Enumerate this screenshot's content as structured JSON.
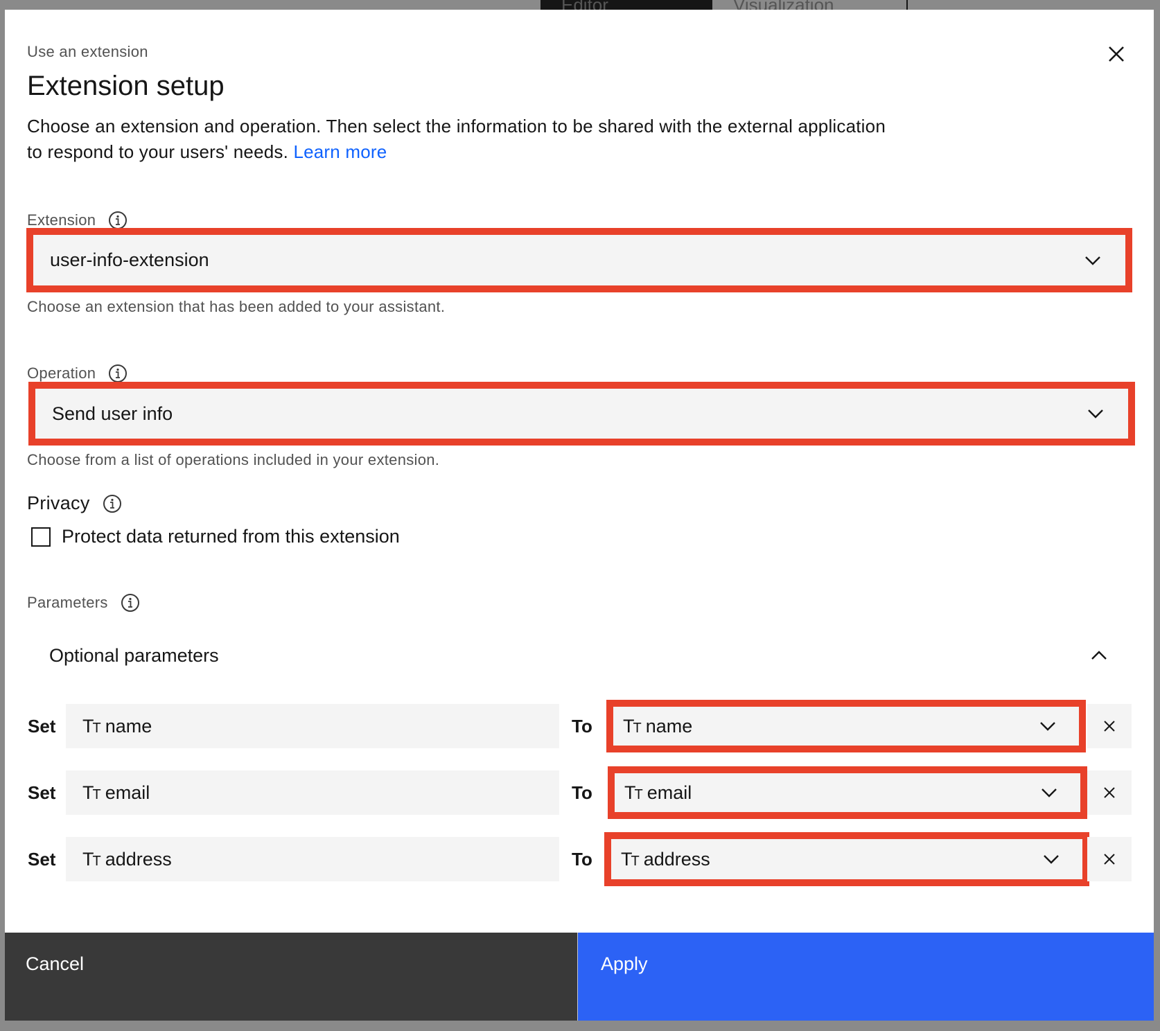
{
  "background": {
    "tabs": [
      {
        "label": "Editor",
        "active": true
      },
      {
        "label": "Visualization",
        "active": false
      }
    ]
  },
  "modal": {
    "eyebrow": "Use an extension",
    "title": "Extension setup",
    "description": "Choose an extension and operation. Then select the information to be shared with the external application to respond to your users' needs. ",
    "learn_more": "Learn more",
    "close_icon": "close-icon"
  },
  "extension": {
    "label": "Extension",
    "value": "user-info-extension",
    "helper": "Choose an extension that has been added to your assistant."
  },
  "operation": {
    "label": "Operation",
    "value": "Send user info",
    "helper": "Choose from a list of operations included in your extension."
  },
  "privacy": {
    "label": "Privacy",
    "checkbox_label": "Protect data returned from this extension",
    "checked": false
  },
  "parameters": {
    "label": "Parameters",
    "accordion_title": "Optional parameters",
    "expanded": true,
    "set_label": "Set",
    "to_label": "To",
    "type_icon": "text-type-icon",
    "rows": [
      {
        "param": "name",
        "value": "name"
      },
      {
        "param": "email",
        "value": "email"
      },
      {
        "param": "address",
        "value": "address"
      }
    ]
  },
  "footer": {
    "cancel_label": "Cancel",
    "apply_label": "Apply"
  },
  "colors": {
    "highlight": "#e8412a",
    "primary": "#2c62f5",
    "secondary": "#393939",
    "link": "#0f62fe",
    "field_bg": "#f4f4f4"
  }
}
